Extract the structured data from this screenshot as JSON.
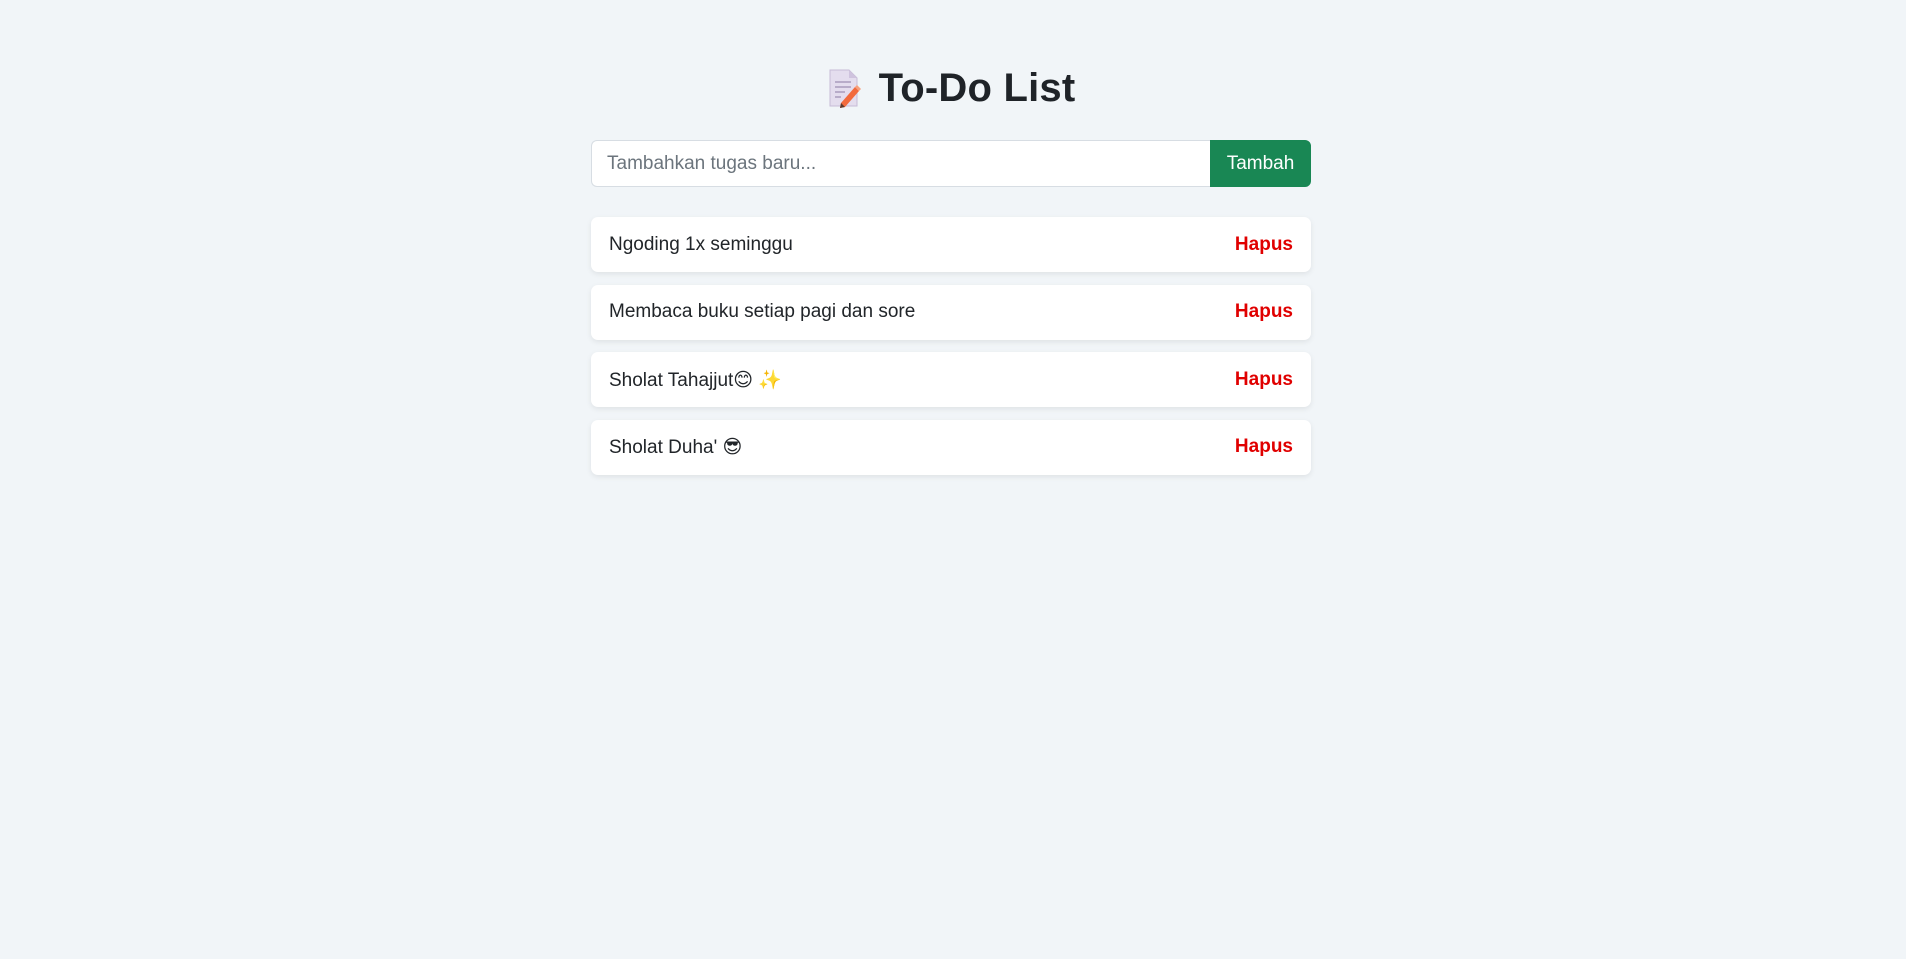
{
  "header": {
    "icon": "memo-icon",
    "title": "To-Do List"
  },
  "form": {
    "input_placeholder": "Tambahkan tugas baru...",
    "input_value": "",
    "add_label": "Tambah"
  },
  "tasks": [
    {
      "text": "Ngoding 1x seminggu",
      "delete_label": "Hapus"
    },
    {
      "text": "Membaca buku setiap pagi dan sore",
      "delete_label": "Hapus"
    },
    {
      "text": "Sholat Tahajjut😊 ✨",
      "delete_label": "Hapus"
    },
    {
      "text": "Sholat Duha' 😎",
      "delete_label": "Hapus"
    }
  ],
  "colors": {
    "background": "#f1f5f8",
    "add_button": "#198754",
    "delete_text": "#e00000"
  }
}
